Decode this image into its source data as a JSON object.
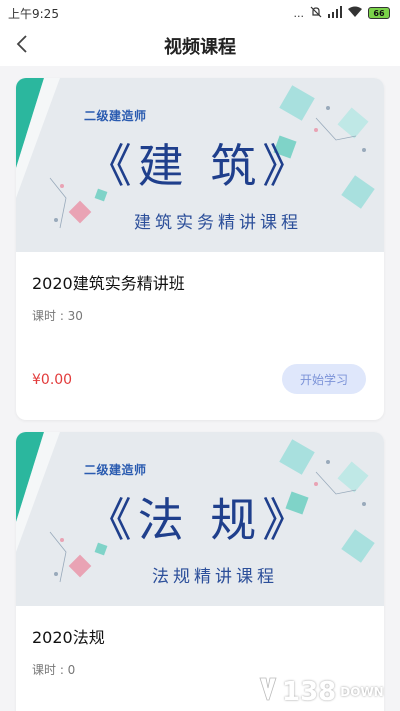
{
  "status_bar": {
    "time": "上午9:25",
    "indicators": "...",
    "battery": "66",
    "icons": [
      "mute-icon",
      "signal-icon",
      "wifi-icon",
      "battery-icon"
    ]
  },
  "nav": {
    "title": "视频课程",
    "back_icon": "chevron-left-icon"
  },
  "courses": [
    {
      "banner_org": "二级建造师",
      "banner_title": "《建 筑》",
      "banner_subtitle": "建筑实务精讲课程",
      "title": "2020建筑实务精讲班",
      "hours": "课时 : 30",
      "price": "¥0.00",
      "button_label": "开始学习"
    },
    {
      "banner_org": "二级建造师",
      "banner_title": "《法 规》",
      "banner_subtitle": "法规精讲课程",
      "title": "2020法规",
      "hours": "课时 : 0"
    }
  ],
  "watermark": {
    "number": "138",
    "suffix": "DOWN"
  },
  "colors": {
    "accent_teal": "#2bb79e",
    "title_blue": "#1f3f8c",
    "price_red": "#e23b3b",
    "button_bg": "#dfe7fb",
    "button_text": "#7c93d8"
  }
}
